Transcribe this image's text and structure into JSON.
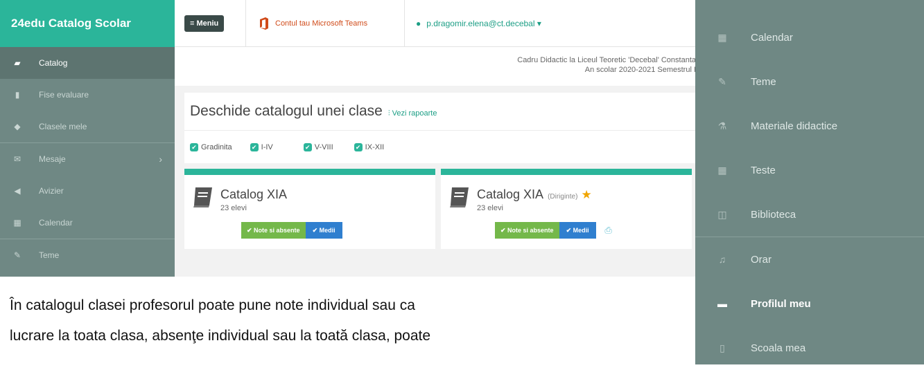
{
  "app": {
    "brand": "24edu Catalog Scolar",
    "sidebar": {
      "items": [
        {
          "label": "Catalog",
          "icon": "book-icon",
          "active": true
        },
        {
          "label": "Fise evaluare",
          "icon": "file-icon",
          "active": false
        },
        {
          "label": "Clasele mele",
          "icon": "graduation-cap-icon",
          "active": false
        },
        {
          "label": "Mesaje",
          "icon": "envelope-icon",
          "active": false,
          "chevron": "›"
        },
        {
          "label": "Avizier",
          "icon": "megaphone-icon",
          "active": false
        },
        {
          "label": "Calendar",
          "icon": "calendar-icon",
          "active": false
        },
        {
          "label": "Teme",
          "icon": "pencil-icon",
          "active": false
        }
      ]
    },
    "topbar": {
      "menu_label": "≡ Meniu",
      "ms_teams_label": "Contul tau Microsoft Teams",
      "user_label": "p.dragomir.elena@ct.decebal ▾"
    },
    "info": {
      "line1": "Cadru Didactic la Liceul Teoretic 'Decebal' Constanta",
      "line2": "An scolar 2020-2021 Semestrul I"
    },
    "panel": {
      "title": "Deschide catalogul unei clase",
      "link": "Vezi rapoarte"
    },
    "filters": [
      {
        "label": "Gradinita"
      },
      {
        "label": "I-IV"
      },
      {
        "label": "V-VIII"
      },
      {
        "label": "IX-XII"
      }
    ],
    "cards": [
      {
        "title": "Catalog XIA",
        "diriginte": "",
        "students": "23 elevi",
        "btn_grades": "✔ Note si absente",
        "btn_avg": "✔ Medii"
      },
      {
        "title": "Catalog XIA",
        "diriginte": "(Diriginte)",
        "students": "23 elevi",
        "btn_grades": "✔ Note si absente",
        "btn_avg": "✔ Medii"
      }
    ]
  },
  "caption": {
    "line1": "În catalogul clasei profesorul poate pune note individual sau ca",
    "line2": "lucrare la toata clasa, absenţe individual sau la toată clasa, poate"
  },
  "right_menu": {
    "items": [
      {
        "label": "Calendar",
        "icon": "calendar-icon"
      },
      {
        "label": "Teme",
        "icon": "pencil-icon"
      },
      {
        "label": "Materiale didactice",
        "icon": "flask-icon"
      },
      {
        "label": "Teste",
        "icon": "calendar-icon"
      },
      {
        "label": "Biblioteca",
        "icon": "book-open-icon"
      },
      {
        "label": "Orar",
        "icon": "bell-icon"
      },
      {
        "label": "Profilul meu",
        "icon": "briefcase-icon"
      },
      {
        "label": "Scoala mea",
        "icon": "building-icon"
      }
    ]
  },
  "colors": {
    "brand_green": "#2bb59a",
    "sidebar": "#6f8884",
    "btn_green": "#74b84a",
    "btn_blue": "#2f7fcf",
    "star": "#f0a500",
    "ms_orange": "#d04b1a"
  }
}
